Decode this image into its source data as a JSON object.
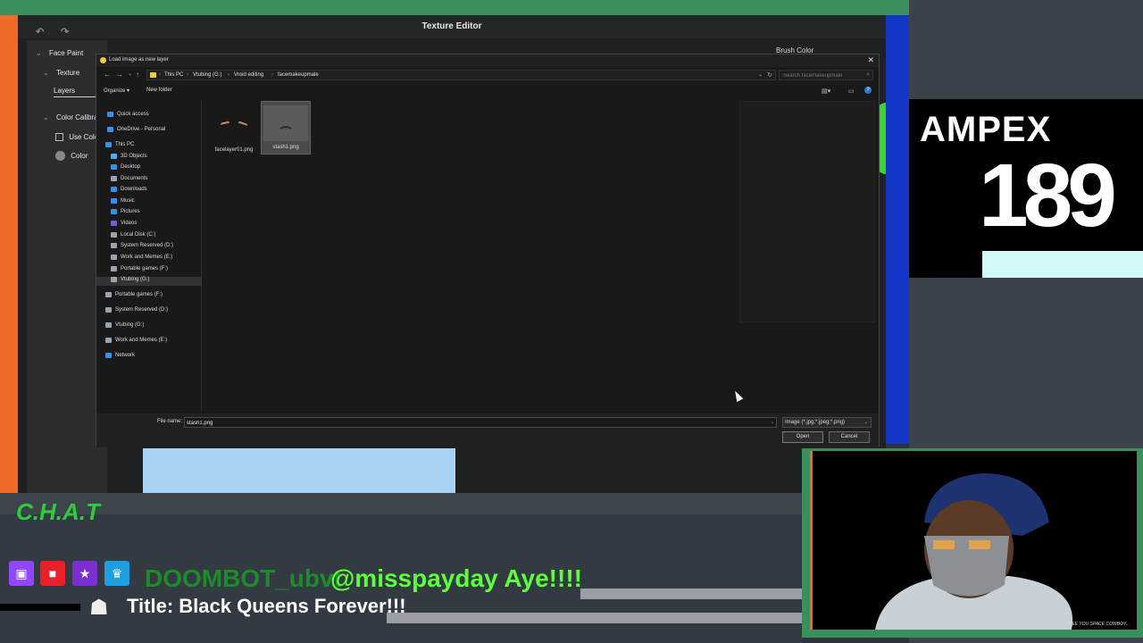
{
  "editor": {
    "title": "Texture Editor",
    "side": {
      "face_paint": "Face Paint",
      "texture": "Texture",
      "layers": "Layers",
      "color_calibration": "Color Calibra",
      "use_color": "Use Colo",
      "color": "Color"
    },
    "brush_color": "Brush Color"
  },
  "dialog": {
    "title": "Load image as new layer",
    "breadcrumb": [
      "This PC",
      "Vtubing (G:)",
      "Vroid editing",
      "facemakeupmale"
    ],
    "search_placeholder": "Search facemakeupmale",
    "organize": "Organize ▾",
    "new_folder": "New folder",
    "nav": [
      {
        "label": "Quick access",
        "icon": "star-icon",
        "color": "#3b8fe0"
      },
      {
        "label": "OneDrive - Personal",
        "icon": "cloud-icon",
        "color": "#3b8fe0"
      },
      {
        "label": "This PC",
        "icon": "computer-icon",
        "color": "#3b8fe0"
      },
      {
        "label": "3D Objects",
        "icon": "cube-icon",
        "color": "#5aa9e6"
      },
      {
        "label": "Desktop",
        "icon": "desktop-icon",
        "color": "#3b8fe0"
      },
      {
        "label": "Documents",
        "icon": "document-icon",
        "color": "#9aa4ae"
      },
      {
        "label": "Downloads",
        "icon": "download-icon",
        "color": "#3b8fe0"
      },
      {
        "label": "Music",
        "icon": "music-icon",
        "color": "#3b8fe0"
      },
      {
        "label": "Pictures",
        "icon": "picture-icon",
        "color": "#3b8fe0"
      },
      {
        "label": "Videos",
        "icon": "video-icon",
        "color": "#7a5ad0"
      },
      {
        "label": "Local Disk (C:)",
        "icon": "drive-icon",
        "color": "#9aa4ae"
      },
      {
        "label": "System Reserved (D:)",
        "icon": "drive-icon",
        "color": "#9aa4ae"
      },
      {
        "label": "Work and Memes (E:)",
        "icon": "drive-icon",
        "color": "#9aa4ae"
      },
      {
        "label": "Portable games (F:)",
        "icon": "drive-icon",
        "color": "#9aa4ae"
      },
      {
        "label": "Vtubing (G:)",
        "icon": "drive-icon",
        "color": "#9aa4ae"
      },
      {
        "label": "Portable games (F:)",
        "icon": "drive-icon",
        "color": "#9aa4ae"
      },
      {
        "label": "System Reserved (D:)",
        "icon": "drive-icon",
        "color": "#9aa4ae"
      },
      {
        "label": "Vtubing (G:)",
        "icon": "drive-icon",
        "color": "#9aa4ae"
      },
      {
        "label": "Work and Memes (E:)",
        "icon": "drive-icon",
        "color": "#9aa4ae"
      },
      {
        "label": "Network",
        "icon": "network-icon",
        "color": "#3b8fe0"
      }
    ],
    "files": [
      {
        "name": "facelayer01.png"
      },
      {
        "name": "stash1.png"
      }
    ],
    "file_name_label": "File name:",
    "file_name_value": "stash1.png",
    "filter": "Image (*.jpg;*.jpeg;*.png)",
    "open": "Open",
    "cancel": "Cancel"
  },
  "ampex": {
    "brand": "AMPEX",
    "number": "189"
  },
  "webcam": {
    "caption": "SEE YOU SPACE COWBOY..."
  },
  "chat": {
    "logo": "C.H.A.T",
    "user": "DOOMBOT_ubvt",
    "message": "@misspayday Aye!!!!",
    "title": "Title: Black Queens Forever!!!"
  }
}
